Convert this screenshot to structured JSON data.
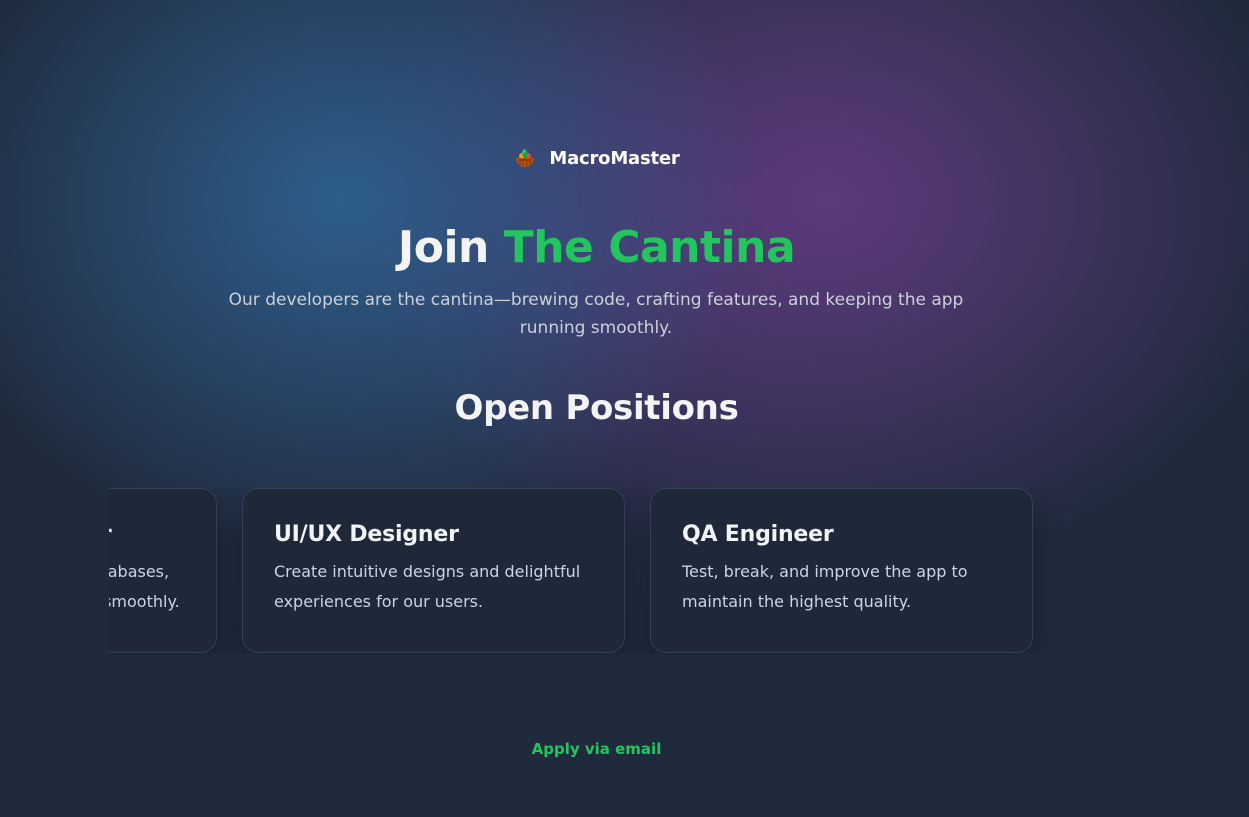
{
  "brand": {
    "name": "MacroMaster",
    "logo_icon": "salad-bowl-icon"
  },
  "hero": {
    "title_prefix": "Join",
    "title_accent": "The Cantina",
    "subtitle": "Our developers are the cantina—brewing code, crafting features, and keeping the app running smoothly."
  },
  "positions": {
    "heading": "Open Positions",
    "items": [
      {
        "title": "Back-End Developer",
        "description": "Build robust APIs, manage databases, and keep everything running smoothly."
      },
      {
        "title": "UI/UX Designer",
        "description": "Create intuitive designs and delightful experiences for our users."
      },
      {
        "title": "QA Engineer",
        "description": "Test, break, and improve the app to maintain the highest quality."
      }
    ]
  },
  "cta": {
    "apply_label": "Apply via email"
  },
  "colors": {
    "accent": "#22c55e",
    "background": "#1f2a3c",
    "card_background": "#1f2839"
  }
}
